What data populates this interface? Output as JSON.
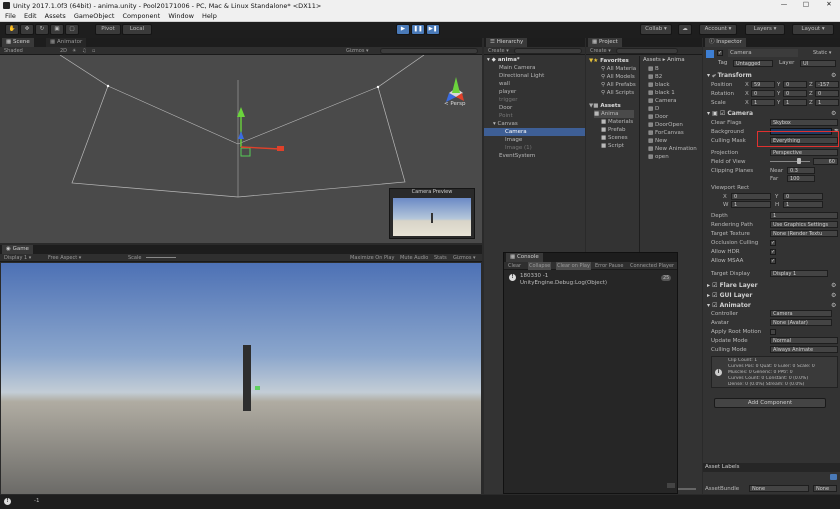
{
  "window": {
    "title": "Unity 2017.1.0f3 (64bit) - anima.unity - Pool20171006 - PC, Mac & Linux Standalone* <DX11>"
  },
  "menu": [
    "File",
    "Edit",
    "Assets",
    "GameObject",
    "Component",
    "Window",
    "Help"
  ],
  "toolbar": {
    "pivot": "Pivot",
    "local": "Local",
    "collab": "Collab ▾",
    "account": "Account ▾",
    "layers": "Layers ▾",
    "layout": "Layout ▾"
  },
  "scene": {
    "tabs": [
      "Scene",
      "Animator"
    ],
    "shaded": "Shaded",
    "mode2d": "2D",
    "gizmos": "Gizmos ▾",
    "persp": "< Persp",
    "camera_preview": "Camera Preview"
  },
  "game": {
    "tab": "Game",
    "display": "Display 1 ▾",
    "aspect": "Free Aspect ▾",
    "scale": "Scale",
    "maximize": "Maximize On Play",
    "mute": "Mute Audio",
    "stats": "Stats",
    "gizmos": "Gizmos ▾"
  },
  "hierarchy": {
    "tab": "Hierarchy",
    "create": "Create ▾",
    "scene": "anima*",
    "items": [
      "Main Camera",
      "Directional Light",
      "wall",
      "player",
      "trigger",
      "Door",
      "Point",
      "Canvas",
      "Camera",
      "Image",
      "Image (1)",
      "EventSystem"
    ]
  },
  "project": {
    "tab": "Project",
    "create": "Create ▾",
    "favorites": "Favorites",
    "favorites_items": [
      "All Materia",
      "All Models",
      "All Prefabs",
      "All Scripts"
    ],
    "assets": "Assets",
    "assets_items": [
      "Anima",
      "Materials",
      "Prefab",
      "Scenes",
      "Script"
    ],
    "breadcrumb": "Assets ▸ Anima",
    "files": [
      "B",
      "B2",
      "black",
      "black 1",
      "Camera",
      "D",
      "Door",
      "DoorOpen",
      "ForCanvas",
      "New",
      "New Animation",
      "open"
    ]
  },
  "console": {
    "tab": "Console",
    "buttons": [
      "Clear",
      "Collapse",
      "Clear on Play",
      "Error Pause",
      "Connected Player ▾"
    ],
    "log_line1": "180330    -1",
    "log_line2": "UnityEngine.Debug:Log(Object)",
    "count": "25"
  },
  "inspector": {
    "tab": "Inspector",
    "name": "Camera",
    "static": "Static ▾",
    "tag_label": "Tag",
    "tag": "Untagged",
    "layer_label": "Layer",
    "layer": "UI",
    "transform": {
      "title": "Transform",
      "position": {
        "label": "Position",
        "x": "59",
        "y": "0",
        "z": "-157"
      },
      "rotation": {
        "label": "Rotation",
        "x": "0",
        "y": "0",
        "z": "0"
      },
      "scale": {
        "label": "Scale",
        "x": "1",
        "y": "1",
        "z": "1"
      }
    },
    "camera": {
      "title": "Camera",
      "clear_flags_label": "Clear Flags",
      "clear_flags": "Skybox",
      "background_label": "Background",
      "culling_mask_label": "Culling Mask",
      "culling_mask": "Everything",
      "projection_label": "Projection",
      "projection": "Perspective",
      "fov_label": "Field of View",
      "fov": "60",
      "clipping_label": "Clipping Planes",
      "near_label": "Near",
      "near": "0.3",
      "far_label": "Far",
      "far": "100",
      "viewport_label": "Viewport Rect",
      "vx": "0",
      "vy": "0",
      "vw": "1",
      "vh": "1",
      "depth_label": "Depth",
      "depth": "1",
      "rendering_path_label": "Rendering Path",
      "rendering_path": "Use Graphics Settings",
      "target_texture_label": "Target Texture",
      "target_texture": "None (Render Textu",
      "occlusion_label": "Occlusion Culling",
      "hdr_label": "Allow HDR",
      "msaa_label": "Allow MSAA",
      "target_display_label": "Target Display",
      "target_display": "Display 1"
    },
    "flare_layer": "Flare Layer",
    "gui_layer": "GUI Layer",
    "animator": {
      "title": "Animator",
      "controller_label": "Controller",
      "controller": "Camera",
      "avatar_label": "Avatar",
      "avatar": "None (Avatar)",
      "root_motion_label": "Apply Root Motion",
      "update_mode_label": "Update Mode",
      "update_mode": "Normal",
      "culling_mode_label": "Culling Mode",
      "culling_mode": "Always Animate",
      "info": [
        "Clip Count: 1",
        "Curves Pos: 0 Quat: 0 Euler: 0 Scale: 0",
        "Muscles: 0 Generic: 0 PPtr: 0",
        "Curves Count: 0 Constant: 0 (0.0%)",
        "Dense: 0 (0.0%) Stream: 0 (0.0%)"
      ]
    },
    "add_component": "Add Component",
    "asset_labels": "Asset Labels",
    "asset_bundle_label": "AssetBundle",
    "asset_bundle": "None",
    "asset_bundle_variant": "None"
  },
  "status": {
    "text": "-1"
  },
  "colors": {
    "highlight": "#e0312f",
    "selection": "#3e5f96"
  }
}
